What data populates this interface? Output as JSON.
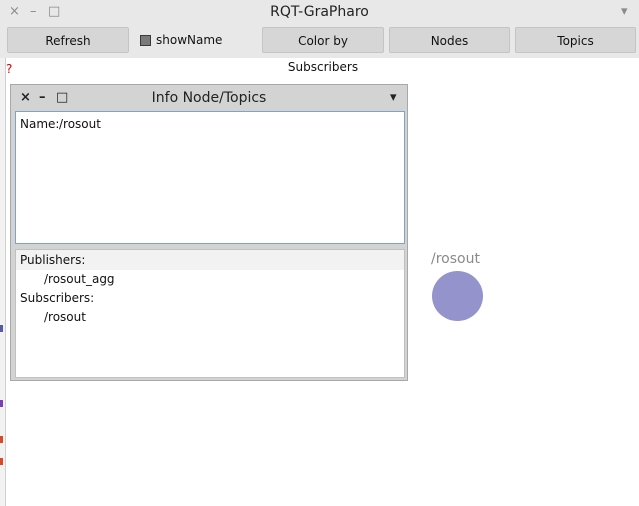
{
  "window": {
    "title": "RQT-GraPharo",
    "close_glyph": "×",
    "minimize_glyph": "–",
    "maximize_glyph": "□",
    "menu_glyph": "▾"
  },
  "toolbar": {
    "refresh_label": "Refresh",
    "show_name_label": "showName",
    "color_label": "Color by Subscribers",
    "nodes_label": "Nodes",
    "topics_label": "Topics"
  },
  "status_mark": "?",
  "panel": {
    "title": "Info Node/Topics",
    "close_glyph": "×",
    "minimize_glyph": "–",
    "maximize_glyph": "□",
    "menu_glyph": "▾",
    "name_label": "Name:",
    "name_value": "/rosout",
    "publishers_label": "Publishers:",
    "publishers": [
      "/rosout_agg"
    ],
    "subscribers_label": "Subscribers:",
    "subscribers": [
      "/rosout"
    ]
  },
  "graph": {
    "node_label": "/rosout",
    "node_color": "#9593cc"
  }
}
